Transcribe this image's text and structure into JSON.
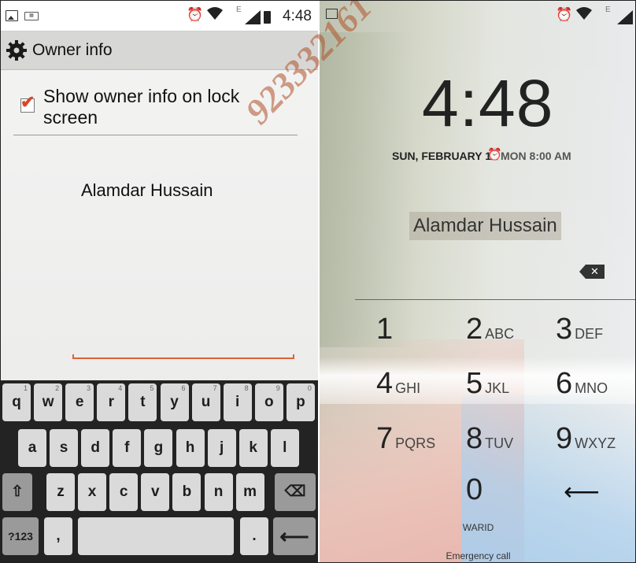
{
  "left": {
    "status_bar": {
      "time": "4:48",
      "network_type": "E",
      "icons": [
        "image-notification-icon",
        "keyboard-notification-icon",
        "alarm-icon",
        "wifi-icon",
        "signal-icon",
        "battery-icon"
      ]
    },
    "app_bar": {
      "title": "Owner info",
      "icon": "gear-icon"
    },
    "checkbox": {
      "label": "Show owner info on lock screen",
      "checked": true
    },
    "owner_text": "Alamdar Hussain",
    "keyboard": {
      "row1": [
        {
          "key": "q",
          "sup": "1"
        },
        {
          "key": "w",
          "sup": "2"
        },
        {
          "key": "e",
          "sup": "3"
        },
        {
          "key": "r",
          "sup": "4"
        },
        {
          "key": "t",
          "sup": "5"
        },
        {
          "key": "y",
          "sup": "6"
        },
        {
          "key": "u",
          "sup": "7"
        },
        {
          "key": "i",
          "sup": "8"
        },
        {
          "key": "o",
          "sup": "9"
        },
        {
          "key": "p",
          "sup": "0"
        }
      ],
      "row2": [
        "a",
        "s",
        "d",
        "f",
        "g",
        "h",
        "j",
        "k",
        "l"
      ],
      "row3": [
        "z",
        "x",
        "c",
        "v",
        "b",
        "n",
        "m"
      ],
      "shift_glyph": "⇧",
      "delete_glyph": "⌫",
      "symbols_label": "?123",
      "comma_label": ",",
      "period_label": ".",
      "enter_glyph": "⟵"
    }
  },
  "right": {
    "status_bar": {
      "network_type": "E",
      "icons": [
        "image-notification-icon",
        "alarm-icon",
        "wifi-icon",
        "signal-icon"
      ]
    },
    "clock": "4:48",
    "date": "SUN, FEBRUARY 1",
    "alarm": "MON 8:00 AM",
    "owner_info": "Alamdar Hussain",
    "pinpad": [
      {
        "digit": "1",
        "letters": ""
      },
      {
        "digit": "2",
        "letters": "ABC"
      },
      {
        "digit": "3",
        "letters": "DEF"
      },
      {
        "digit": "4",
        "letters": "GHI"
      },
      {
        "digit": "5",
        "letters": "JKL"
      },
      {
        "digit": "6",
        "letters": "MNO"
      },
      {
        "digit": "7",
        "letters": "PQRS"
      },
      {
        "digit": "8",
        "letters": "TUV"
      },
      {
        "digit": "9",
        "letters": "WXYZ"
      },
      {
        "digit": "0",
        "letters": ""
      }
    ],
    "enter_glyph": "⟵",
    "carrier": "WARID",
    "emergency_call": "Emergency call"
  },
  "watermark": "923332161"
}
